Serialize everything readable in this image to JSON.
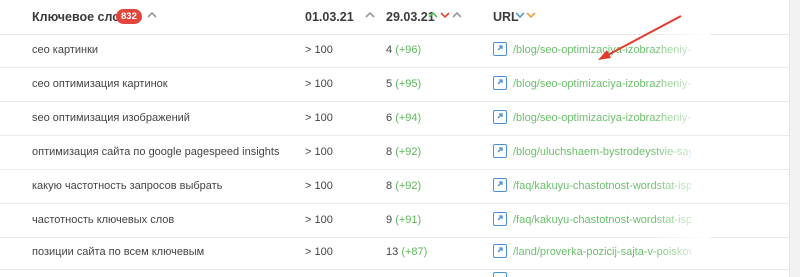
{
  "header": {
    "keyword_label": "Ключевое слово",
    "keyword_count": "832",
    "date1_label": "01.03.21",
    "date2_label": "29.03.21",
    "url_label": "URL"
  },
  "colors": {
    "badge": "#e2453c",
    "positive_delta": "#5cb85c",
    "url_text": "#6cbf6c",
    "link_icon": "#4a8fd8",
    "arrow": "#e23b2e"
  },
  "rows": [
    {
      "keyword": "сео картинки",
      "pos1": "> 100",
      "pos2": "4",
      "delta": "(+96)",
      "url": "/blog/seo-optimizaciya-izobrazheniy-dlya-poiska-google"
    },
    {
      "keyword": "сео оптимизация картинок",
      "pos1": "> 100",
      "pos2": "5",
      "delta": "(+95)",
      "url": "/blog/seo-optimizaciya-izobrazheniy-dlya-poiska-google"
    },
    {
      "keyword": "seo оптимизация изображений",
      "pos1": "> 100",
      "pos2": "6",
      "delta": "(+94)",
      "url": "/blog/seo-optimizaciya-izobrazheniy-dlya-poiska-google"
    },
    {
      "keyword": "оптимизация сайта по google pagespeed insights",
      "pos1": "> 100",
      "pos2": "8",
      "delta": "(+92)",
      "url": "/blog/uluchshaem-bystrodeystvie-sayta-s-pomoshyu"
    },
    {
      "keyword": "какую частотность запросов выбрать",
      "pos1": "> 100",
      "pos2": "8",
      "delta": "(+92)",
      "url": "/faq/kakuyu-chastotnost-wordstat-ispolzovat-dlya"
    },
    {
      "keyword": "частотность ключевых слов",
      "pos1": "> 100",
      "pos2": "9",
      "delta": "(+91)",
      "url": "/faq/kakuyu-chastotnost-wordstat-ispolzovat-dlya"
    },
    {
      "keyword": "позиции сайта по всем ключевым",
      "pos1": "> 100",
      "pos2": "13",
      "delta": "(+87)",
      "url": "/land/proverka-pozicij-sajta-v-poiskovyh-sistemah"
    }
  ]
}
